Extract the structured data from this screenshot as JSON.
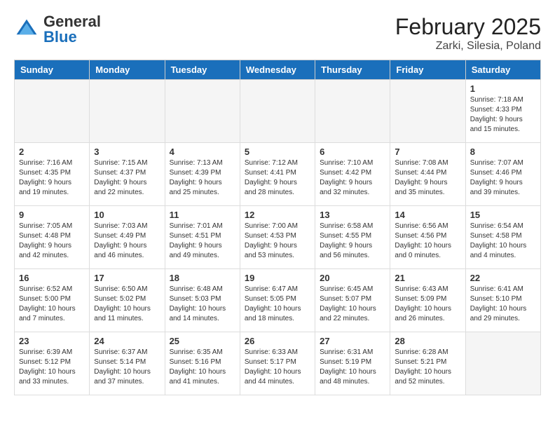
{
  "header": {
    "logo_general": "General",
    "logo_blue": "Blue",
    "title": "February 2025",
    "subtitle": "Zarki, Silesia, Poland"
  },
  "days_of_week": [
    "Sunday",
    "Monday",
    "Tuesday",
    "Wednesday",
    "Thursday",
    "Friday",
    "Saturday"
  ],
  "weeks": [
    [
      {
        "day": "",
        "info": ""
      },
      {
        "day": "",
        "info": ""
      },
      {
        "day": "",
        "info": ""
      },
      {
        "day": "",
        "info": ""
      },
      {
        "day": "",
        "info": ""
      },
      {
        "day": "",
        "info": ""
      },
      {
        "day": "1",
        "info": "Sunrise: 7:18 AM\nSunset: 4:33 PM\nDaylight: 9 hours and 15 minutes."
      }
    ],
    [
      {
        "day": "2",
        "info": "Sunrise: 7:16 AM\nSunset: 4:35 PM\nDaylight: 9 hours and 19 minutes."
      },
      {
        "day": "3",
        "info": "Sunrise: 7:15 AM\nSunset: 4:37 PM\nDaylight: 9 hours and 22 minutes."
      },
      {
        "day": "4",
        "info": "Sunrise: 7:13 AM\nSunset: 4:39 PM\nDaylight: 9 hours and 25 minutes."
      },
      {
        "day": "5",
        "info": "Sunrise: 7:12 AM\nSunset: 4:41 PM\nDaylight: 9 hours and 28 minutes."
      },
      {
        "day": "6",
        "info": "Sunrise: 7:10 AM\nSunset: 4:42 PM\nDaylight: 9 hours and 32 minutes."
      },
      {
        "day": "7",
        "info": "Sunrise: 7:08 AM\nSunset: 4:44 PM\nDaylight: 9 hours and 35 minutes."
      },
      {
        "day": "8",
        "info": "Sunrise: 7:07 AM\nSunset: 4:46 PM\nDaylight: 9 hours and 39 minutes."
      }
    ],
    [
      {
        "day": "9",
        "info": "Sunrise: 7:05 AM\nSunset: 4:48 PM\nDaylight: 9 hours and 42 minutes."
      },
      {
        "day": "10",
        "info": "Sunrise: 7:03 AM\nSunset: 4:49 PM\nDaylight: 9 hours and 46 minutes."
      },
      {
        "day": "11",
        "info": "Sunrise: 7:01 AM\nSunset: 4:51 PM\nDaylight: 9 hours and 49 minutes."
      },
      {
        "day": "12",
        "info": "Sunrise: 7:00 AM\nSunset: 4:53 PM\nDaylight: 9 hours and 53 minutes."
      },
      {
        "day": "13",
        "info": "Sunrise: 6:58 AM\nSunset: 4:55 PM\nDaylight: 9 hours and 56 minutes."
      },
      {
        "day": "14",
        "info": "Sunrise: 6:56 AM\nSunset: 4:56 PM\nDaylight: 10 hours and 0 minutes."
      },
      {
        "day": "15",
        "info": "Sunrise: 6:54 AM\nSunset: 4:58 PM\nDaylight: 10 hours and 4 minutes."
      }
    ],
    [
      {
        "day": "16",
        "info": "Sunrise: 6:52 AM\nSunset: 5:00 PM\nDaylight: 10 hours and 7 minutes."
      },
      {
        "day": "17",
        "info": "Sunrise: 6:50 AM\nSunset: 5:02 PM\nDaylight: 10 hours and 11 minutes."
      },
      {
        "day": "18",
        "info": "Sunrise: 6:48 AM\nSunset: 5:03 PM\nDaylight: 10 hours and 14 minutes."
      },
      {
        "day": "19",
        "info": "Sunrise: 6:47 AM\nSunset: 5:05 PM\nDaylight: 10 hours and 18 minutes."
      },
      {
        "day": "20",
        "info": "Sunrise: 6:45 AM\nSunset: 5:07 PM\nDaylight: 10 hours and 22 minutes."
      },
      {
        "day": "21",
        "info": "Sunrise: 6:43 AM\nSunset: 5:09 PM\nDaylight: 10 hours and 26 minutes."
      },
      {
        "day": "22",
        "info": "Sunrise: 6:41 AM\nSunset: 5:10 PM\nDaylight: 10 hours and 29 minutes."
      }
    ],
    [
      {
        "day": "23",
        "info": "Sunrise: 6:39 AM\nSunset: 5:12 PM\nDaylight: 10 hours and 33 minutes."
      },
      {
        "day": "24",
        "info": "Sunrise: 6:37 AM\nSunset: 5:14 PM\nDaylight: 10 hours and 37 minutes."
      },
      {
        "day": "25",
        "info": "Sunrise: 6:35 AM\nSunset: 5:16 PM\nDaylight: 10 hours and 41 minutes."
      },
      {
        "day": "26",
        "info": "Sunrise: 6:33 AM\nSunset: 5:17 PM\nDaylight: 10 hours and 44 minutes."
      },
      {
        "day": "27",
        "info": "Sunrise: 6:31 AM\nSunset: 5:19 PM\nDaylight: 10 hours and 48 minutes."
      },
      {
        "day": "28",
        "info": "Sunrise: 6:28 AM\nSunset: 5:21 PM\nDaylight: 10 hours and 52 minutes."
      },
      {
        "day": "",
        "info": ""
      }
    ]
  ]
}
